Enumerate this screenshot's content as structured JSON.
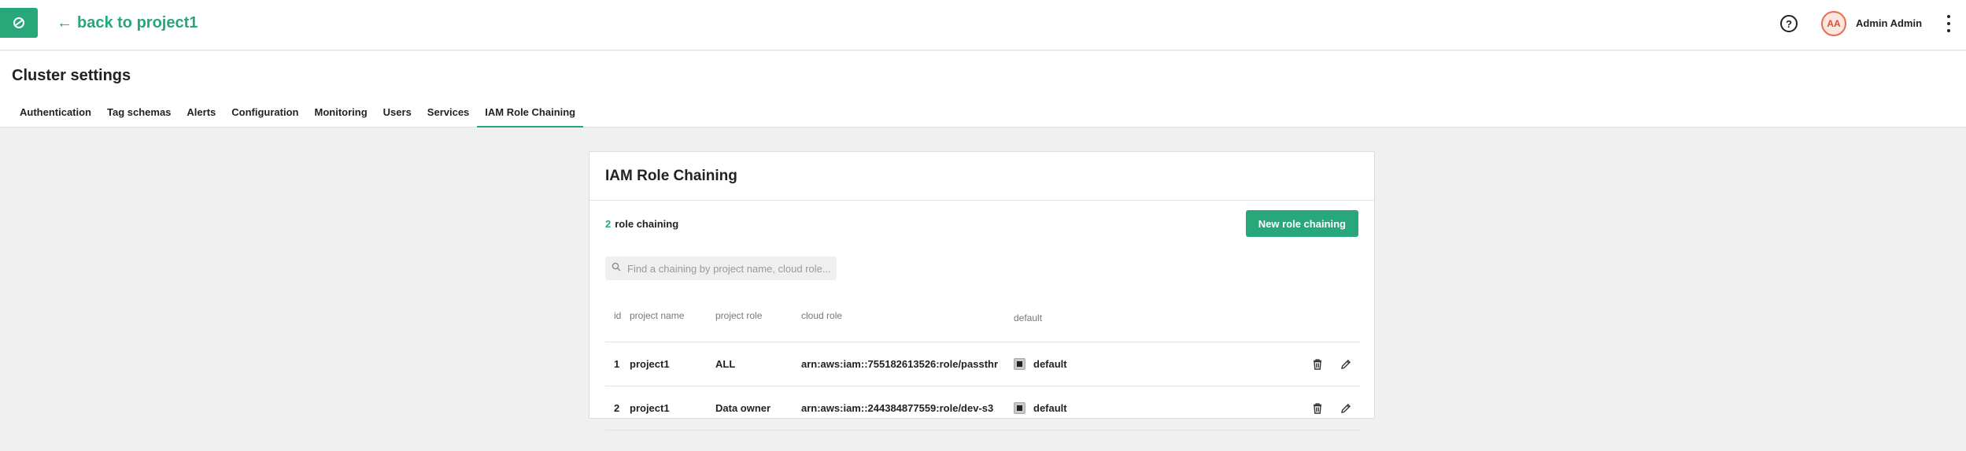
{
  "topbar": {
    "back_label": "back to project1",
    "help_label": "?",
    "avatar_initials": "AA",
    "user_name": "Admin Admin"
  },
  "settings": {
    "title": "Cluster settings",
    "tabs": [
      {
        "label": "Authentication"
      },
      {
        "label": "Tag schemas"
      },
      {
        "label": "Alerts"
      },
      {
        "label": "Configuration"
      },
      {
        "label": "Monitoring"
      },
      {
        "label": "Users"
      },
      {
        "label": "Services"
      },
      {
        "label": "IAM Role Chaining"
      }
    ],
    "active_tab": "IAM Role Chaining"
  },
  "card": {
    "title": "IAM Role Chaining",
    "count": "2",
    "count_label": "role chaining",
    "new_button_label": "New role chaining",
    "search_placeholder": "Find a chaining by project name, cloud role...",
    "columns": {
      "id": "id",
      "project_name": "project name",
      "project_role": "project role",
      "cloud_role": "cloud role",
      "default": "default"
    },
    "rows": [
      {
        "id": "1",
        "project_name": "project1",
        "project_role": "ALL",
        "cloud_role": "arn:aws:iam::755182613526:role/passthr",
        "default_label": "default"
      },
      {
        "id": "2",
        "project_name": "project1",
        "project_role": "Data owner",
        "cloud_role": "arn:aws:iam::244384877559:role/dev-s3",
        "default_label": "default"
      }
    ]
  },
  "colors": {
    "accent": "#27a77a",
    "avatar_border": "#e46e4d",
    "background": "#f0f0f0"
  },
  "icons": [
    "logo-icon",
    "back-arrow-icon",
    "help-icon",
    "kebab-menu-icon",
    "search-icon",
    "trash-icon",
    "pencil-icon"
  ]
}
